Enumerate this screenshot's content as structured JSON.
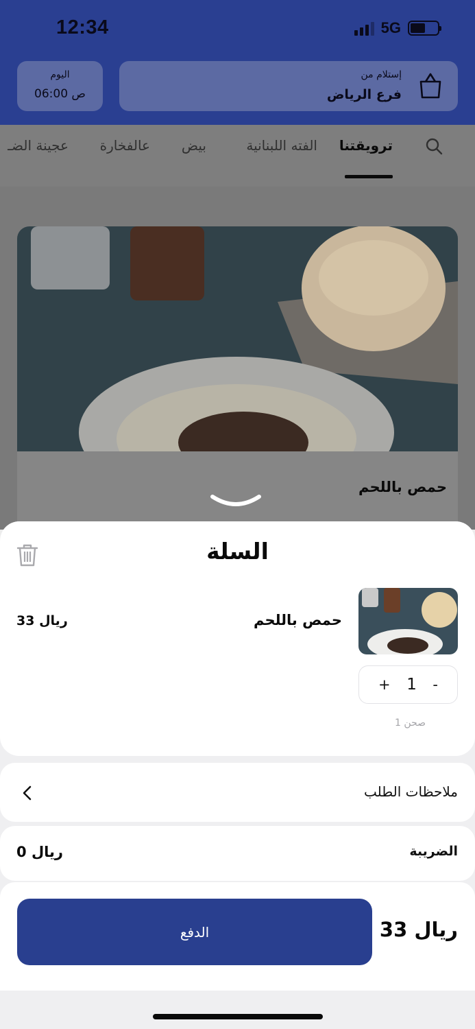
{
  "status_bar": {
    "time": "12:34",
    "network": "5G",
    "battery_level": 0.55
  },
  "header": {
    "pickup_label": "إستلام من",
    "branch": "فرع الرياض",
    "day_label": "اليوم",
    "time": "06:00 ص"
  },
  "tabs": [
    {
      "label": "ترويقتنا",
      "active": true
    },
    {
      "label": "الفته اللبنانية",
      "active": false
    },
    {
      "label": "بيض",
      "active": false
    },
    {
      "label": "عالفخارة",
      "active": false
    },
    {
      "label": "عجينة الضـ",
      "active": false
    }
  ],
  "menu_card": {
    "title": "حمص باللحم"
  },
  "cart": {
    "title": "السلة",
    "item": {
      "name": "حمص باللحم",
      "price": "33 ريال",
      "quantity": "1",
      "servings": "1 صحن",
      "plus": "+",
      "minus": "-"
    },
    "notes_label": "ملاحظات الطلب",
    "tax_label": "الضريبة",
    "tax_value": "0 ريال",
    "total": "33 ريال",
    "pay_label": "الدفع"
  },
  "colors": {
    "brand": "#293f8f",
    "sheet_bg": "#efeff1"
  }
}
